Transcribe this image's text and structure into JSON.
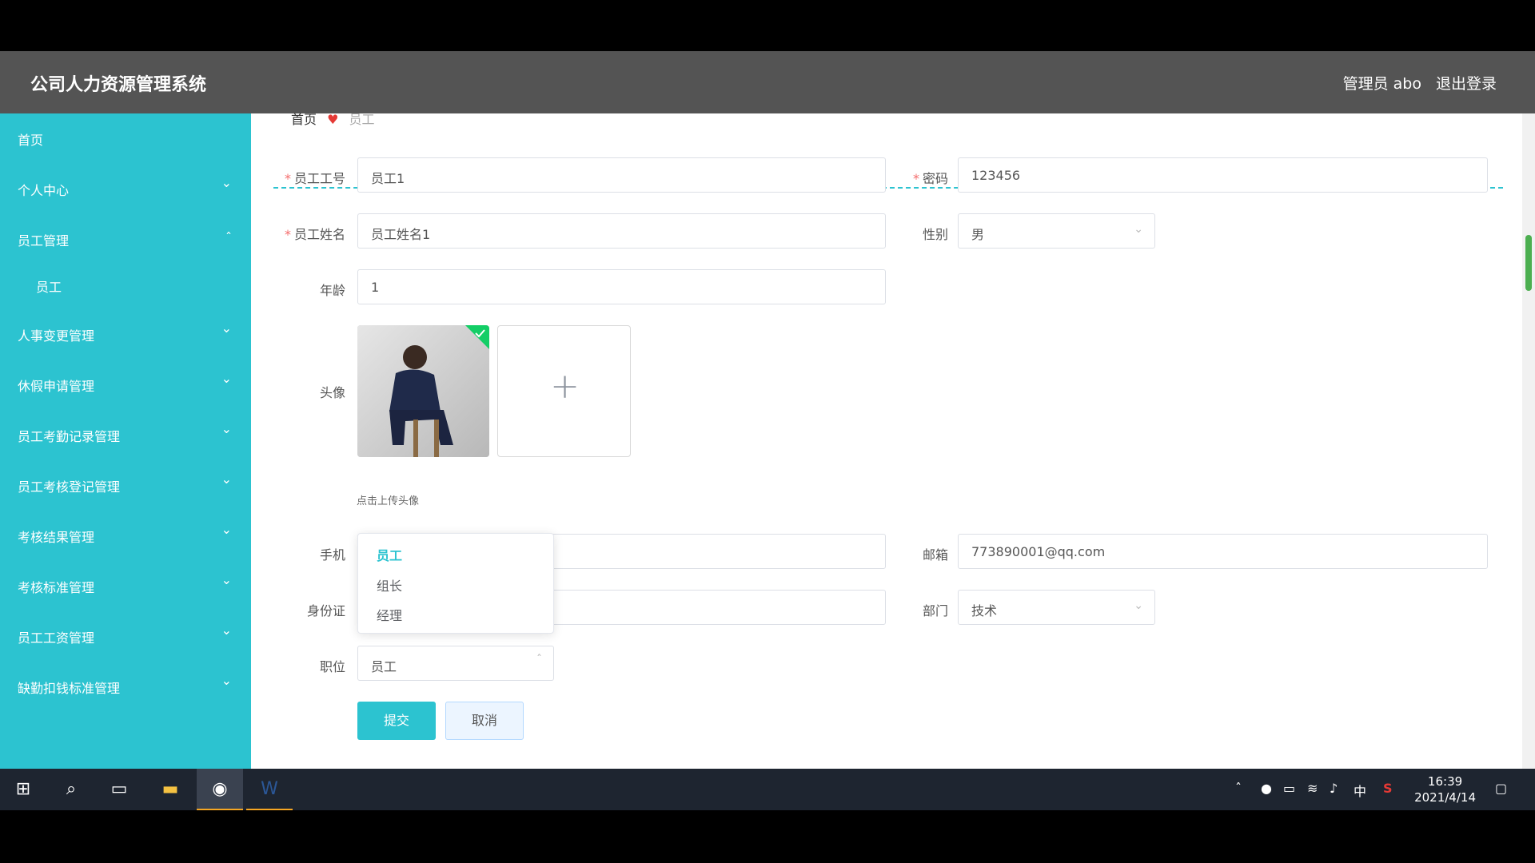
{
  "header": {
    "title": "公司人力资源管理系统",
    "user": "管理员 abo",
    "logout": "退出登录"
  },
  "sidebar": {
    "items": [
      {
        "label": "首页"
      },
      {
        "label": "个人中心"
      },
      {
        "label": "员工管理"
      },
      {
        "label": "员工"
      },
      {
        "label": "人事变更管理"
      },
      {
        "label": "休假申请管理"
      },
      {
        "label": "员工考勤记录管理"
      },
      {
        "label": "员工考核登记管理"
      },
      {
        "label": "考核结果管理"
      },
      {
        "label": "考核标准管理"
      },
      {
        "label": "员工工资管理"
      },
      {
        "label": "缺勤扣钱标准管理"
      }
    ]
  },
  "breadcrumb": {
    "home": "首页",
    "last": "员工"
  },
  "form": {
    "employee_no": {
      "label": "员工工号",
      "value": "员工1"
    },
    "password": {
      "label": "密码",
      "value": "123456"
    },
    "employee_name": {
      "label": "员工姓名",
      "value": "员工姓名1"
    },
    "gender": {
      "label": "性别",
      "value": "男"
    },
    "age": {
      "label": "年龄",
      "value": "1"
    },
    "avatar": {
      "label": "头像",
      "hint": "点击上传头像"
    },
    "phone": {
      "label": "手机",
      "value": ""
    },
    "email": {
      "label": "邮箱",
      "value": "773890001@qq.com"
    },
    "id_card": {
      "label": "身份证",
      "value": ""
    },
    "department": {
      "label": "部门",
      "value": "技术"
    },
    "position": {
      "label": "职位",
      "value": "员工",
      "options": [
        "员工",
        "组长",
        "经理"
      ]
    },
    "submit": "提交",
    "cancel": "取消"
  },
  "taskbar": {
    "time": "16:39",
    "date": "2021/4/14",
    "ime": "中"
  },
  "colors": {
    "accent": "#2cc3d0",
    "header_bg": "#545454"
  }
}
